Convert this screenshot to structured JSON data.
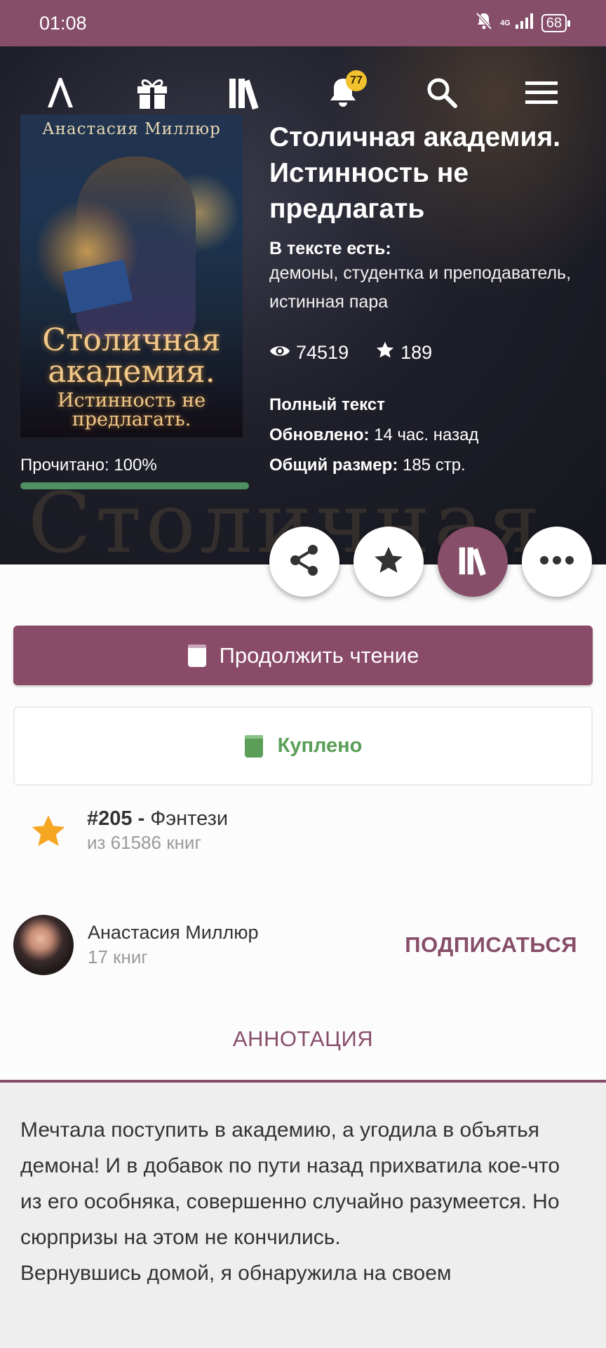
{
  "status_bar": {
    "time": "01:08",
    "network": "4G",
    "battery": "68"
  },
  "nav": {
    "notifications_count": "77",
    "items": [
      "logo-icon",
      "gift-icon",
      "library-icon",
      "bell-icon",
      "search-icon",
      "menu-icon"
    ]
  },
  "book": {
    "cover": {
      "author": "Анастасия Миллюр",
      "title_line1": "Столичная",
      "title_line2": "академия.",
      "title_line3": "Истинность не",
      "title_line4": "предлагать."
    },
    "hero_background_text": "Столичная",
    "title": "Столичная академия. Истинность не предлагать",
    "tags_label": "В тексте есть:",
    "tags": "демоны, студентка и преподаватель, истинная пара",
    "views": "74519",
    "likes": "189",
    "status": "Полный текст",
    "updated_label": "Обновлено:",
    "updated_value": "14 час. назад",
    "size_label": "Общий размер:",
    "size_value": "185 стр.",
    "read_progress": "Прочитано: 100%",
    "read_fraction": 1.0
  },
  "actions": [
    "share-icon",
    "star-icon",
    "library-icon",
    "more-icon"
  ],
  "buttons": {
    "continue": "Продолжить чтение",
    "bought": "Куплено"
  },
  "rating": {
    "rank": "#205 -",
    "genre": "Фэнтези",
    "of_total": "из 61586 книг"
  },
  "author": {
    "name": "Анастасия Миллюр",
    "books": "17 книг",
    "subscribe": "ПОДПИСАТЬСЯ"
  },
  "tab": {
    "label": "АННОТАЦИЯ"
  },
  "annotation": {
    "p1": "Мечтала поступить в академию, а угодила в объятья демона! И в добавок по пути назад прихватила кое-что из его особняка, совершенно случайно разумеется. Но сюрпризы на этом не кончились.",
    "p2": "Вернувшись домой, я обнаружила на своем"
  },
  "colors": {
    "accent": "#864e69",
    "success": "#5a9e57",
    "progress": "#4f8f62",
    "badge": "#f2c12e",
    "rank_star": "#f5a623"
  }
}
